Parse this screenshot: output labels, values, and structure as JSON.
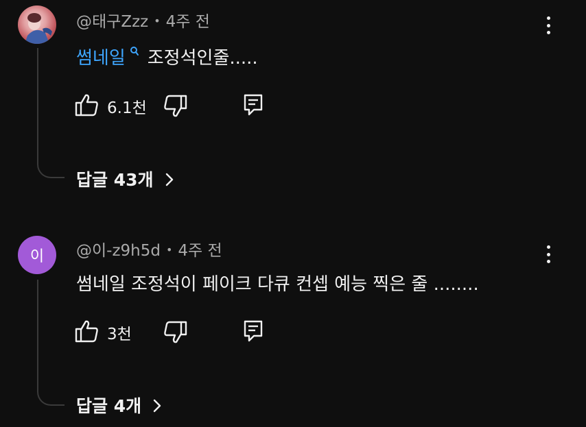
{
  "comments": [
    {
      "author": "@태구Zzz",
      "time": "4주 전",
      "avatar_type": "photo",
      "avatar_letter": "",
      "link_text": "썸네일",
      "text": "조정석인줄.....",
      "likes": "6.1천",
      "replies_label": "답글 43개",
      "has_link": true
    },
    {
      "author": "@이-z9h5d",
      "time": "4주 전",
      "avatar_type": "letter",
      "avatar_letter": "이",
      "link_text": "",
      "text": "썸네일 조정석이 페이크 다큐 컨셉 예능 찍은 줄 ........",
      "likes": "3천",
      "replies_label": "답글 4개",
      "has_link": false
    }
  ],
  "separator": "•",
  "colors": {
    "background": "#0f0f0f",
    "link": "#3ea6ff",
    "meta": "#aaaaaa",
    "text": "#f1f1f1",
    "avatar_letter_bg": "#a25ad8"
  },
  "icons": [
    "like-icon",
    "dislike-icon",
    "reply-icon",
    "more-icon",
    "chevron-right-icon",
    "search-icon"
  ]
}
